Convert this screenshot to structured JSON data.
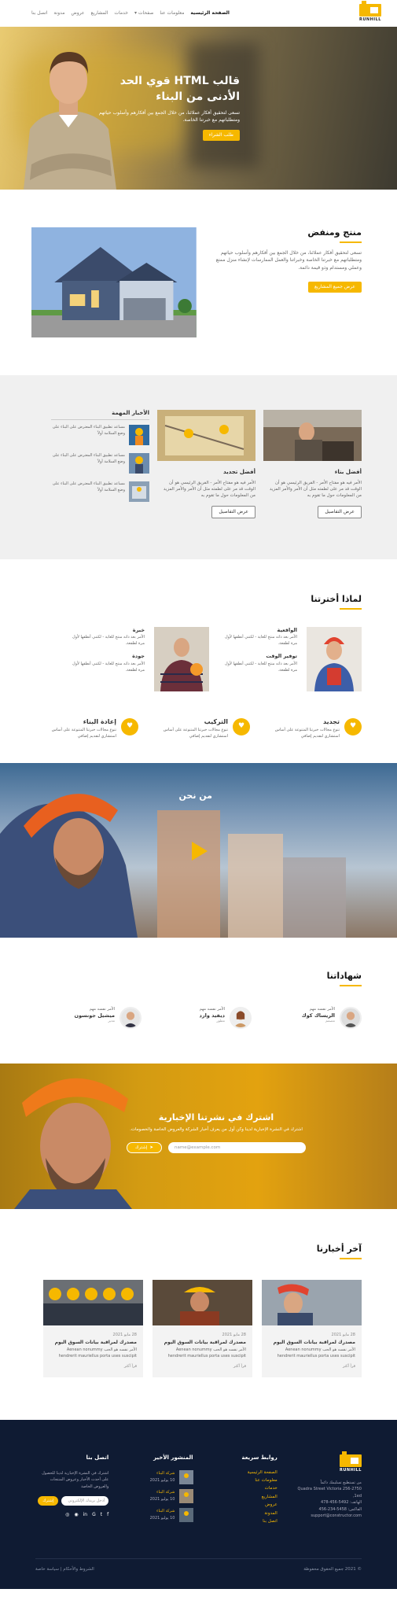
{
  "brand": {
    "logo_text": "RUNHILL"
  },
  "nav": {
    "items": [
      "الصفحة الرئيسية",
      "معلومات عنا",
      "صفحات",
      "خدمات",
      "المشاريع",
      "عروض",
      "مدونة",
      "اتصل بنا"
    ]
  },
  "hero": {
    "title": "قالب HTML قوي الحد الأدنى من البناء",
    "text": "تسعى لتحقيق أفكار عملائنا، من خلال الجمع بين أفكارهم وأسلوب حياتهم ومتطلباتهم مع خبرتنا الخاصة.",
    "button": "طلب الشراء"
  },
  "about": {
    "title": "منتج ومنفض",
    "text": "تسعى لتحقيق أفكار عملائنا، من خلال الجمع بين أفكارهم وأسلوب حياتهم ومتطلباتهم مع خبرتنا الخاصة وخبراتنا والعمل الممارسات لإنشاء منزل ممتع وعملي ومستدام وذو قيمة دائمة.",
    "button": "عرض جميع المشاريع"
  },
  "news": {
    "cards": [
      {
        "title": "أفضل بناء",
        "text": "الأمر فيه هو مفتاح الأمر - الفريق الرئيسي هو أن الوقت قد مر على لطمته مثل أن الأمر والأمر المزيد من المعلومات حول ما تقوم به",
        "button": "عرض التفاصيل"
      },
      {
        "title": "أفضل تجديد",
        "text": "الأمر فيه هو مفتاح الأمر - الفريق الرئيسي هو أن الوقت قد مر على لطمته مثل أن الأمر والأمر المزيد من المعلومات حول ما تقوم به",
        "button": "عرض التفاصيل"
      }
    ],
    "important": {
      "title": "الأخبار المهمة",
      "items": [
        "مساعد تطبيق البناء المعترض على البناء على وضع السلامة أولاً",
        "مساعد تطبيق البناء المعترض على البناء على وضع السلامة أولاً",
        "مساعد تطبيق البناء المعترض على البناء على وضع السلامة أولاً"
      ]
    }
  },
  "why": {
    "title": "لماذا أخترتنا",
    "left": [
      {
        "title": "الواقعية",
        "text": "الأمر بعد ذاته منتج للغاية - لكنني أنطقها لأول مرة لطفعة."
      },
      {
        "title": "توفير الوقت",
        "text": "الأمر بعد ذاته منتج للغاية - لكنني أنطقها لأول مرة لطفعة."
      }
    ],
    "right": [
      {
        "title": "خبرة",
        "text": "الأمر بعد ذاته منتج للغاية - لكنني أنطقها لأول مرة لطفعة."
      },
      {
        "title": "جودة",
        "text": "الأمر بعد ذاته منتج للغاية - لكنني أنطقها لأول مرة لطفعة."
      }
    ],
    "features": [
      {
        "title": "تجديد",
        "text": "تنوع مجالات خبرتنا المتنوعة على أساس استشاري لتقديم إضافي"
      },
      {
        "title": "التركيب",
        "text": "تنوع مجالات خبرتنا المتنوعة على أساس استشاري لتقديم إضافي"
      },
      {
        "title": "إعادة البناء",
        "text": "تنوع مجالات خبرتنا المتنوعة على أساس استشاري لتقديم إضافي"
      }
    ]
  },
  "video": {
    "title": "من نحن"
  },
  "testimonials": {
    "title": "شهاداتنا",
    "items": [
      {
        "quote": "الأمر نفسه مهم",
        "name": "الريساك كوك",
        "role": "مصمم"
      },
      {
        "quote": "الأمر نفسه مهم",
        "name": "ديفيد وارد",
        "role": "مطور"
      },
      {
        "quote": "الأمر نفسه مهم",
        "name": "ميشيل جونسون",
        "role": "مدير"
      }
    ]
  },
  "newsletter": {
    "title": "اشترك في نشرتنا الإخبارية",
    "text": "اشترك في النشرة الإخبارية لدينا وكن أول من يعرف أخبار الشركة والعروض الخاصة والخصومات.",
    "placeholder": "name@example.com",
    "button": "إشترك"
  },
  "latest": {
    "title": "آخر أخبارنا",
    "cards": [
      {
        "date": "28 مايو 2021",
        "title": "مصدرك لمراقبة بيانات السوق اليوم",
        "text": "Aenean nonummy الأمر نفسه هو الحب hendrerit mauriellus porta uses suscipit",
        "more": "قرأ أكثر"
      },
      {
        "date": "28 مايو 2021",
        "title": "مصدرك لمراقبة بيانات السوق اليوم",
        "text": "Aenean nonummy الأمر نفسه هو الحب hendrerit mauriellus porta uses suscipit",
        "more": "قرأ أكثر"
      },
      {
        "date": "28 مايو 2021",
        "title": "مصدرك لمراقبة بيانات السوق اليوم",
        "text": "Aenean nonummy الأمر نفسه هو الحب hendrerit mauriellus porta uses suscipit",
        "more": "قرأ أكثر"
      }
    ]
  },
  "footer": {
    "about_text": "من تستطيع تسليمك دائماً",
    "address": "Quadra Street Victoria 256-2750 ,1ed",
    "phone": "الهاتف: 5492-456-478",
    "fax": "الفاكس: 5458-234-456",
    "email": "support@constructor.com",
    "links_title": "روابط سريعة",
    "links": [
      "الصفحة الرئيسية",
      "معلومات عنا",
      "خدمات",
      "المشاريع",
      "عروض",
      "المدونة",
      "اتصل بنا"
    ],
    "posts_title": "المنشور الأخير",
    "posts": [
      {
        "title": "شركة البناء",
        "date": "10 يوليو 2021"
      },
      {
        "title": "شركة البناء",
        "date": "10 يوليو 2021"
      },
      {
        "title": "شركة البناء",
        "date": "10 يوليو 2021"
      }
    ],
    "contact_title": "اتصل بنا",
    "contact_text": "اشترك في النشرة الإخبارية لدينا للحصول على أحدث الأخبار وعروض المنتجات والعروض الخاصة",
    "sub_placeholder": "أدخل بريدك الإلكتروني",
    "sub_button": "إشترك",
    "copyright": "© 2021 جميع الحقوق محفوظة",
    "policy": "الشروط والأحكام | سياسة خاصة"
  },
  "colors": {
    "accent": "#f6b800",
    "footer": "#0f1b33"
  }
}
